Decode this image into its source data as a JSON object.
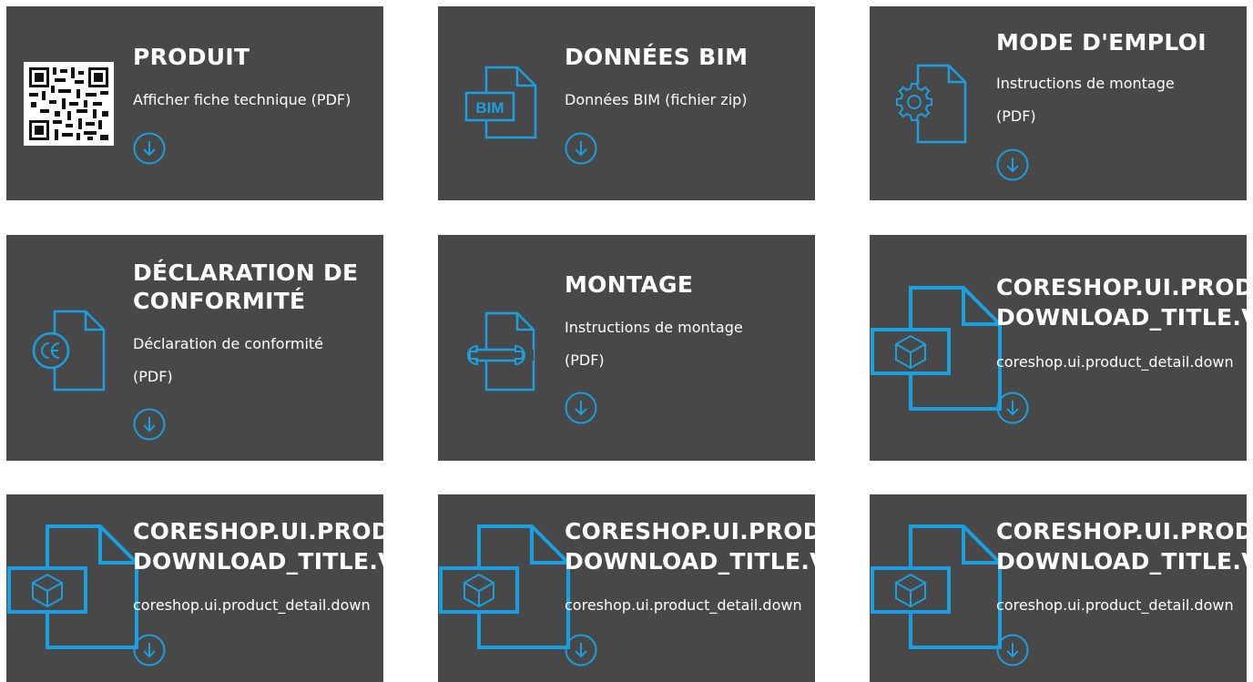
{
  "accent_color": "#1a9fe0",
  "card_color": "#484848",
  "cards": [
    {
      "title": "PRODUIT",
      "description": "Afficher fiche technique (PDF)",
      "icon": "qr-code-icon"
    },
    {
      "title": "DONNÉES BIM",
      "description": "Données BIM (fichier zip)",
      "icon": "bim-file-icon",
      "icon_text": "BIM"
    },
    {
      "title": "MODE D'EMPLOI",
      "description": "Instructions de montage",
      "description2": "(PDF)",
      "icon": "gear-file-icon"
    },
    {
      "title": "DÉCLARATION DE",
      "title2": "CONFORMITÉ",
      "description": "Déclaration de conformité",
      "description2": "(PDF)",
      "icon": "ce-file-icon"
    },
    {
      "title": "MONTAGE",
      "description": "Instructions de montage",
      "description2": "(PDF)",
      "icon": "wrench-file-icon"
    },
    {
      "title": "CORESHOP.UI.PROD",
      "title2": "DOWNLOAD_TITLE.V",
      "description": "coreshop.ui.product_detail.down",
      "icon": "cube-file-icon"
    },
    {
      "title": "CORESHOP.UI.PROD",
      "title2": "DOWNLOAD_TITLE.V",
      "description": "coreshop.ui.product_detail.down",
      "icon": "cube-file-icon"
    },
    {
      "title": "CORESHOP.UI.PROD",
      "title2": "DOWNLOAD_TITLE.V",
      "description": "coreshop.ui.product_detail.down",
      "icon": "cube-file-icon"
    },
    {
      "title": "CORESHOP.UI.PROD",
      "title2": "DOWNLOAD_TITLE.V",
      "description": "coreshop.ui.product_detail.down",
      "icon": "cube-file-icon"
    }
  ]
}
